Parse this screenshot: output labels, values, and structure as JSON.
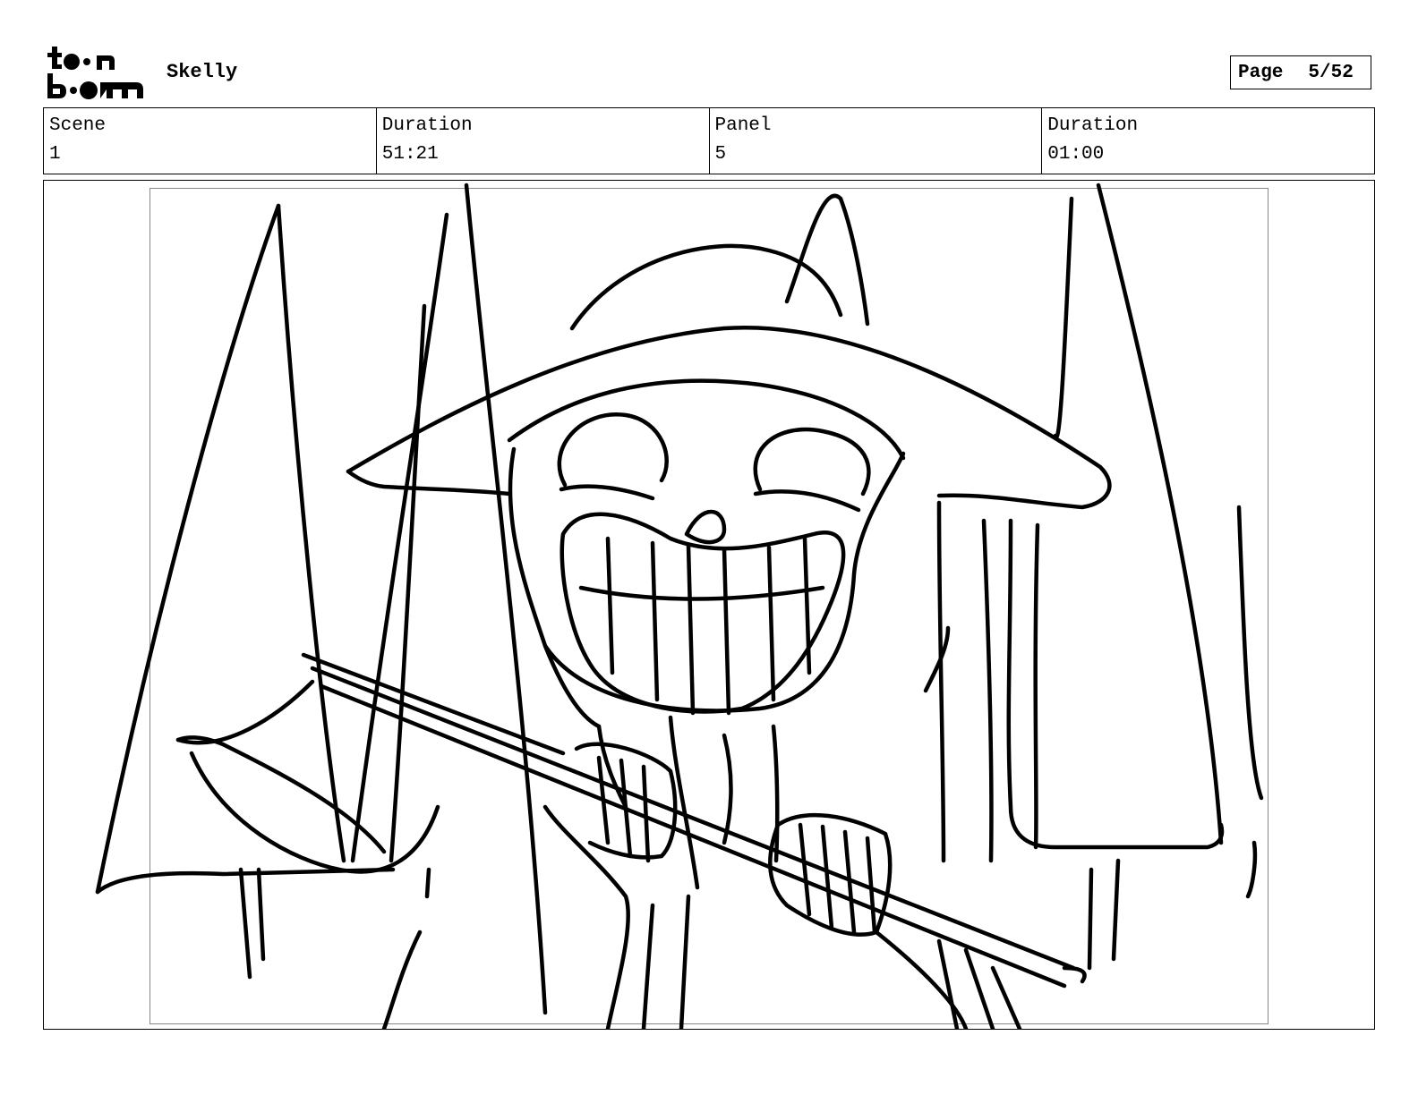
{
  "header": {
    "logo_text": "toon boom",
    "project_title": "Skelly",
    "page_label": "Page",
    "page_value": "5/52"
  },
  "info": [
    {
      "label": "Scene",
      "value": "1"
    },
    {
      "label": "Duration",
      "value": "51:21"
    },
    {
      "label": "Panel",
      "value": "5"
    },
    {
      "label": "Duration",
      "value": "01:00"
    }
  ],
  "panel": {
    "description": ""
  }
}
